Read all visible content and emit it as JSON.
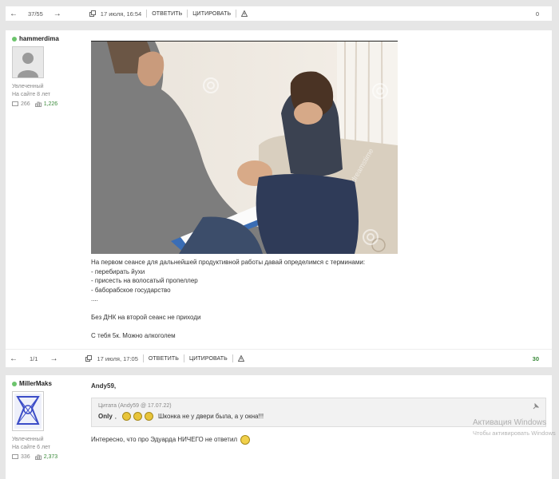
{
  "top_bar": {
    "prev": "←",
    "page": "37/55",
    "next": "→",
    "date": "17 июля, 16:54",
    "reply": "ОТВЕТИТЬ",
    "quote": "ЦИТИРОВАТЬ",
    "score": "0"
  },
  "post1": {
    "username": "hammerdima",
    "rank": "Увлеченный",
    "since": "На сайте 8 лет",
    "comments": "266",
    "rating": "1,226",
    "lines": [
      "На первом сеансе для дальнейшей продуктивной работы давай определимся с терминами:",
      "- перебирать йухи",
      "- присесть на волосатый пропеллер",
      "- баборабское государство",
      "....",
      "",
      "Без ДНК на второй сеанс не приходи",
      "",
      "С тебя 5к. Можно алкоголем"
    ],
    "image_watermark": "dreamstime",
    "bar": {
      "prev": "←",
      "page": "1/1",
      "next": "→",
      "date": "17 июля, 17:05",
      "reply": "ОТВЕТИТЬ",
      "quote": "ЦИТИРОВАТЬ",
      "score": "30"
    }
  },
  "post2": {
    "username": "MillerMaks",
    "rank": "Увлеченный",
    "since": "На сайте 6 лет",
    "comments": "336",
    "rating": "2,373",
    "addressee": "Andy59",
    "quote_header": "Цитата (Andy59 @ 17.07.22)",
    "quote_who": "Only",
    "quote_text": "Шконка не у двери была, а у окна!!!",
    "reply_text": "Интересно, что про Эдуарда НИЧЕГО не ответил"
  },
  "watermark": {
    "line1": "Активация Windows",
    "line2": "Чтобы активировать Windows"
  }
}
